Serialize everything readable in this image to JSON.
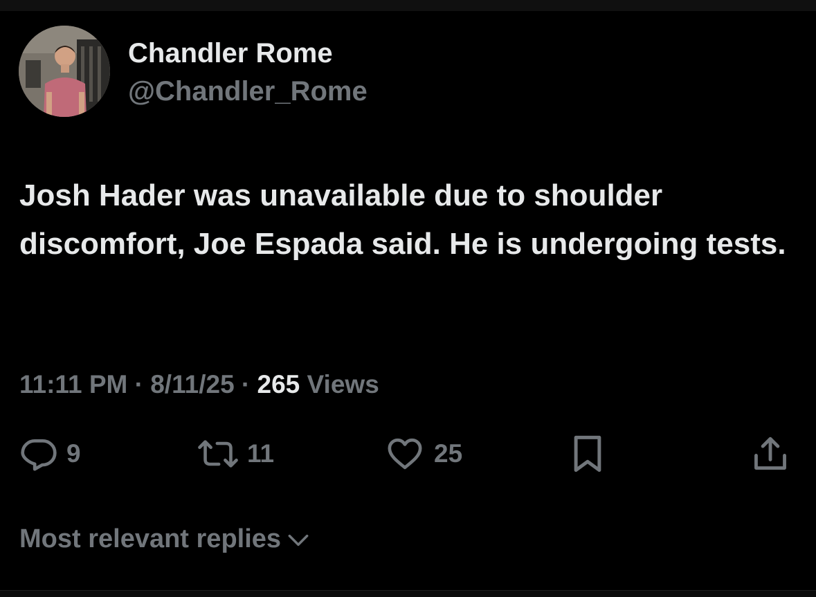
{
  "colors": {
    "background": "#000000",
    "primary_text": "#e7e9ea",
    "secondary_text": "#71767b"
  },
  "author": {
    "display_name": "Chandler Rome",
    "handle": "@Chandler_Rome",
    "avatar_icon": "profile-photo"
  },
  "tweet": {
    "text": "Josh Hader was unavailable due to shoulder discomfort, Joe Espada said. He is undergoing tests."
  },
  "meta": {
    "time": "11:11 PM",
    "separator": "·",
    "date": "8/11/25",
    "views_count": "265",
    "views_label": "Views"
  },
  "actions": {
    "reply": {
      "icon": "reply-icon",
      "count": "9"
    },
    "repost": {
      "icon": "repost-icon",
      "count": "11"
    },
    "like": {
      "icon": "heart-icon",
      "count": "25"
    },
    "bookmark": {
      "icon": "bookmark-icon"
    },
    "share": {
      "icon": "share-icon"
    }
  },
  "replies": {
    "sort_label": "Most relevant replies",
    "chevron_icon": "chevron-down-icon"
  }
}
